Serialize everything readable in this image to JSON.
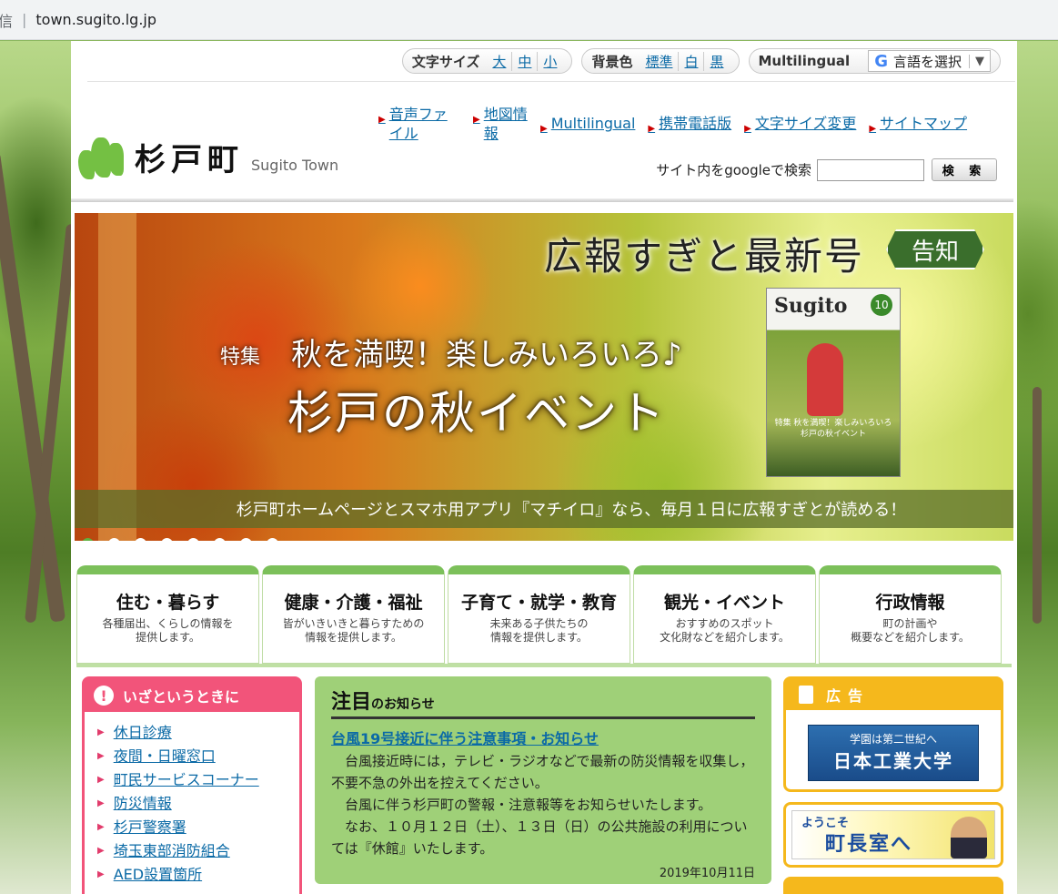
{
  "browser": {
    "security_label": "信",
    "url": "town.sugito.lg.jp"
  },
  "utility": {
    "font_size": {
      "label": "文字サイズ",
      "options": [
        "大",
        "中",
        "小"
      ]
    },
    "bg_color": {
      "label": "背景色",
      "options": [
        "標準",
        "白",
        "黒"
      ]
    },
    "multilingual": {
      "label": "Multilingual",
      "select_value": "言語を選択",
      "google_icon": "G"
    }
  },
  "header": {
    "logo_text": "杉戸町",
    "logo_en": "Sugito Town",
    "nav": [
      "音声ファイル",
      "地図情報",
      "Multilingual",
      "携帯電話版",
      "文字サイズ変更",
      "サイトマップ"
    ],
    "search_label": "サイト内をgoogleで検索",
    "search_value": "",
    "search_button": "検 索"
  },
  "banner": {
    "title": "広報すぎと最新号",
    "tag": "告知",
    "feature_label": "特集",
    "feature_sub": "秋を満喫！楽しみいろいろ♪",
    "feature_main": "杉戸の秋イベント",
    "magazine_title": "Sugito",
    "magazine_number": "10",
    "magazine_lines": "特集 秋を満喫！楽しみいろいろ 杉戸の秋イベント",
    "caption": "杉戸町ホームページとスマホ用アプリ『マチイロ』なら、毎月１日に広報すぎとが読める！",
    "slide_count": 8,
    "active_slide": 1
  },
  "categories": [
    {
      "title": "住む・暮らす",
      "desc1": "各種届出、くらしの情報を",
      "desc2": "提供します。"
    },
    {
      "title": "健康・介護・福祉",
      "desc1": "皆がいきいきと暮らすための",
      "desc2": "情報を提供します。"
    },
    {
      "title": "子育て・就学・教育",
      "desc1": "未来ある子供たちの",
      "desc2": "情報を提供します。"
    },
    {
      "title": "観光・イベント",
      "desc1": "おすすめのスポット",
      "desc2": "文化財などを紹介します。"
    },
    {
      "title": "行政情報",
      "desc1": "町の計画や",
      "desc2": "概要などを紹介します。"
    }
  ],
  "emergency": {
    "title": "いざというときに",
    "icon": "!",
    "items": [
      "休日診療",
      "夜間・日曜窓口",
      "町民サービスコーナー",
      "防災情報",
      "杉戸警察署",
      "埼玉東部消防組合",
      "AED設置箇所"
    ]
  },
  "news": {
    "head_big": "注目",
    "head_small": "のお知らせ",
    "link": "台風19号接近に伴う注意事項・お知らせ",
    "p1": "台風接近時には，テレビ・ラジオなどで最新の防災情報を収集し，不要不急の外出を控えてください。",
    "p2": "台風に伴う杉戸町の警報・注意報等をお知らせいたします。",
    "p3": "なお、１０月１２日（土）、１３日（日）の公共施設の利用については『休館』いたします。",
    "date": "2019年10月11日"
  },
  "ads": {
    "title": "広告",
    "ad_small": "学園は第二世紀へ",
    "ad_large": "日本工業大学",
    "mayor_small": "ようこそ",
    "mayor_large": "町長室へ"
  },
  "colors": {
    "link": "#0b6aa6",
    "accent_green": "#7cc05a",
    "emergency_pink": "#f2547a",
    "ad_orange": "#f5b81c",
    "news_green": "#9fd078"
  }
}
